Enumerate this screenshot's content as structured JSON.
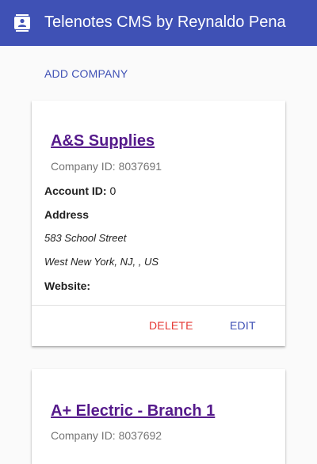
{
  "app": {
    "title": "Telenotes CMS by Reynaldo Pena",
    "icon": "contact-card-icon"
  },
  "actions": {
    "add_company": "ADD COMPANY"
  },
  "companies": [
    {
      "name": "A&S Supplies",
      "company_id_label": "Company ID: 8037691",
      "account_id_label": "Account ID:",
      "account_id_value": "0",
      "address_label": "Address",
      "address_line1": "583 School Street",
      "address_line2": "West New York, NJ, , US",
      "website_label": "Website:",
      "website_value": "",
      "delete_label": "DELETE",
      "edit_label": "EDIT"
    },
    {
      "name": "A+ Electric - Branch 1",
      "company_id_label": "Company ID: 8037692"
    }
  ],
  "colors": {
    "app_bar": "#3f51b5",
    "accent": "#3f51b5",
    "delete": "#e53935",
    "link_visited": "#551a8b"
  }
}
